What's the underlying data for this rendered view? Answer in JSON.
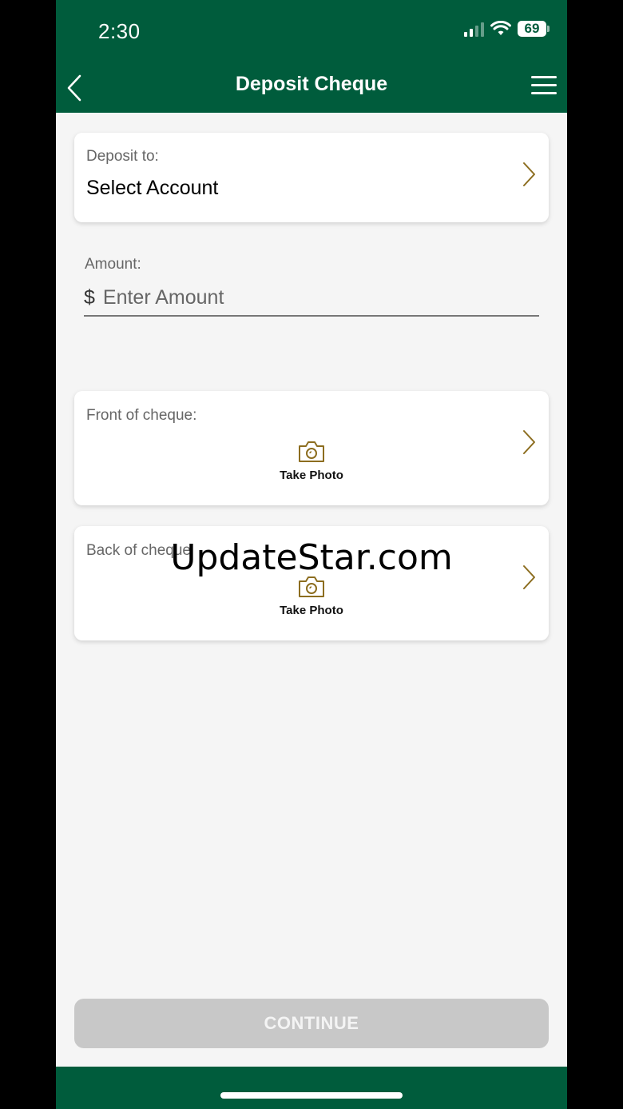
{
  "status_bar": {
    "time": "2:30",
    "battery": "69"
  },
  "header": {
    "title": "Deposit Cheque"
  },
  "deposit_to": {
    "label": "Deposit to:",
    "value": "Select Account"
  },
  "amount": {
    "label": "Amount:",
    "currency": "$",
    "placeholder": "Enter Amount"
  },
  "front": {
    "label": "Front of cheque:",
    "action": "Take Photo"
  },
  "back": {
    "label": "Back of cheque",
    "action": "Take Photo"
  },
  "watermark": "UpdateStar.com",
  "continue_label": "CONTINUE",
  "colors": {
    "brand": "#005c3c",
    "accent_gold": "#8c6d1f",
    "disabled": "#c8c8c8"
  },
  "icons": [
    "chevron-left-icon",
    "hamburger-menu-icon",
    "chevron-right-icon",
    "camera-icon",
    "signal-icon",
    "wifi-icon",
    "battery-icon"
  ]
}
